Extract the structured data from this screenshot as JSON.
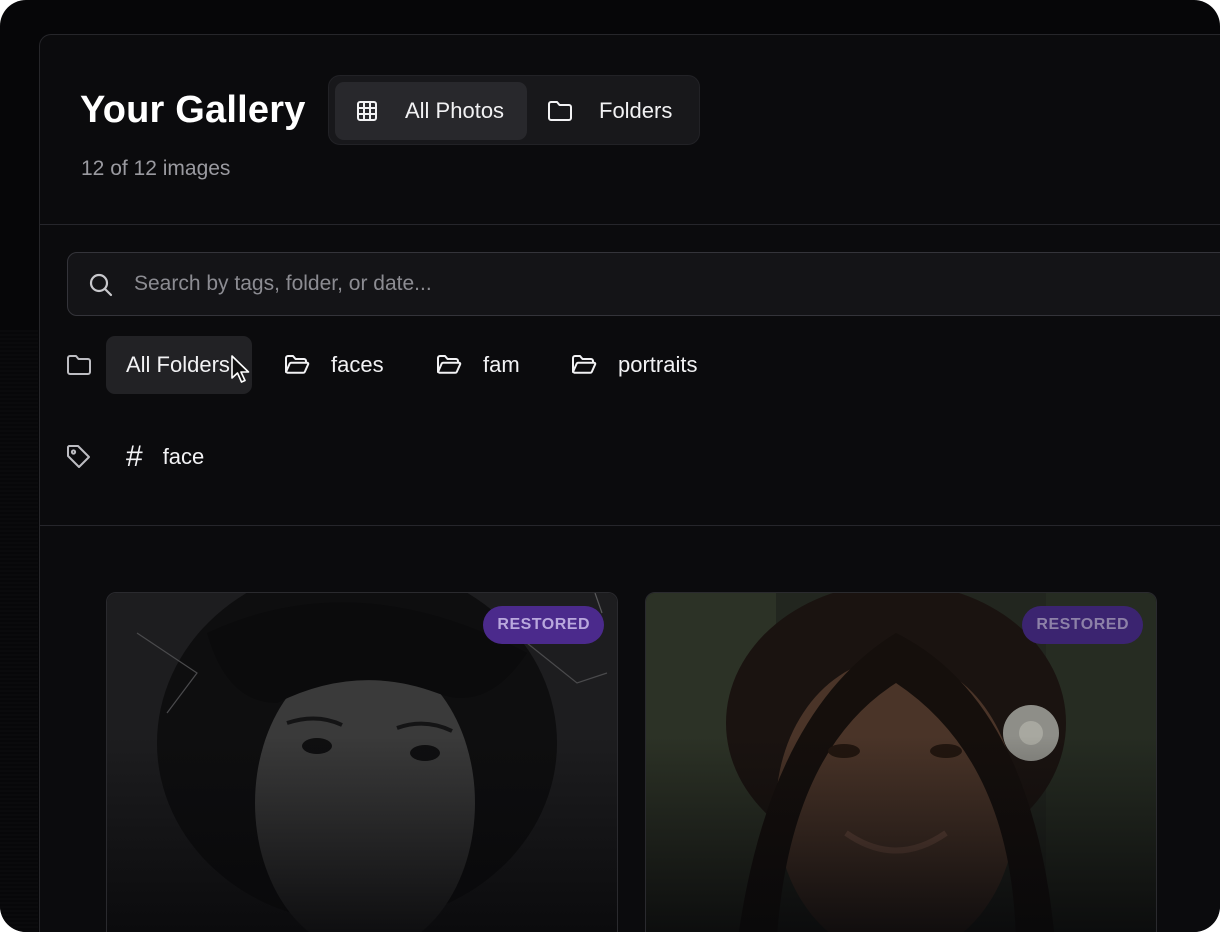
{
  "header": {
    "title": "Your Gallery",
    "image_count": "12 of 12 images"
  },
  "view_toggle": {
    "items": [
      {
        "label": "All Photos",
        "icon": "grid-icon",
        "active": true
      },
      {
        "label": "Folders",
        "icon": "folder-icon",
        "active": false
      }
    ]
  },
  "search": {
    "placeholder": "Search by tags, folder, or date...",
    "value": ""
  },
  "folder_filter": {
    "icon": "folder-icon",
    "items": [
      {
        "label": "All Folders",
        "active": true
      },
      {
        "label": "faces",
        "icon": "folder-open-icon"
      },
      {
        "label": "fam",
        "icon": "folder-open-icon"
      },
      {
        "label": "portraits",
        "icon": "folder-open-icon"
      }
    ]
  },
  "tag_filter": {
    "icon": "tag-icon",
    "items": [
      {
        "label": "face",
        "icon": "hash-icon"
      }
    ]
  },
  "photos": [
    {
      "badge": "RESTORED",
      "badge_color": "#4b2a8c"
    },
    {
      "badge": "RESTORED",
      "badge_color": "#3b2470"
    }
  ],
  "colors": {
    "background": "#060608",
    "panel": "#0b0b0d",
    "accent_badge": "#4b2a8c",
    "text_primary": "#f2f2f4",
    "text_muted": "#9a9aa0"
  }
}
